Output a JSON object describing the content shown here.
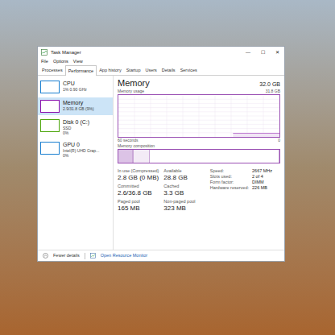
{
  "window": {
    "title": "Task Manager",
    "controls": [
      "—",
      "☐",
      "✕"
    ]
  },
  "menu": [
    "File",
    "Options",
    "View"
  ],
  "tabs": [
    {
      "label": "Processes",
      "selected": false
    },
    {
      "label": "Performance",
      "selected": true
    },
    {
      "label": "App history",
      "selected": false
    },
    {
      "label": "Startup",
      "selected": false
    },
    {
      "label": "Users",
      "selected": false
    },
    {
      "label": "Details",
      "selected": false
    },
    {
      "label": "Services",
      "selected": false
    }
  ],
  "sidebar": {
    "items": [
      {
        "name": "CPU",
        "details": [
          "1%  0.90 GHz"
        ],
        "selected": false,
        "color": "#1a7fd0"
      },
      {
        "name": "Memory",
        "details": [
          "2.9/31.8 GB (9%)"
        ],
        "selected": true,
        "color": "#8b12ae"
      },
      {
        "name": "Disk 0 (C:)",
        "details": [
          "SSD",
          "0%"
        ],
        "selected": false,
        "color": "#4da60c"
      },
      {
        "name": "GPU 0",
        "details": [
          "Intel(R) UHD Grap...",
          "0%"
        ],
        "selected": false,
        "color": "#1a7fd0"
      }
    ]
  },
  "panel": {
    "title": "Memory",
    "total": "32.0 GB",
    "usage_label": "Memory usage",
    "usage_max": "31.8 GB",
    "time_label": "60 seconds",
    "min_label": "0",
    "composition_label": "Memory composition",
    "usage_max_value": 31.8,
    "usage_series": [
      2.9,
      2.9,
      2.9,
      2.9,
      2.9,
      2.9,
      2.9,
      2.9,
      2.9,
      2.9,
      2.9,
      2.9,
      2.9,
      2.9,
      2.9,
      2.9,
      2.9,
      2.9
    ],
    "composition": [
      {
        "level": 0.09,
        "color": "#dcc3e6"
      },
      {
        "level": 0.006,
        "color": "#b88bc9"
      },
      {
        "level": 0.1,
        "color": "#f3ebf6"
      },
      {
        "level": 0.804,
        "color": "#ffffff"
      }
    ]
  },
  "stats": [
    {
      "label": "In use (Compressed)",
      "value": "2.8 GB (0 MB)"
    },
    {
      "label": "Available",
      "value": "28.8 GB"
    },
    {
      "label": "Committed",
      "value": "2.6/36.8 GB"
    },
    {
      "label": "Cached",
      "value": "3.3 GB"
    },
    {
      "label": "Paged pool",
      "value": "165 MB"
    },
    {
      "label": "Non-paged pool",
      "value": "323 MB"
    }
  ],
  "specs": [
    {
      "label": "Speed:",
      "value": "2667 MHz"
    },
    {
      "label": "Slots used:",
      "value": "2 of 4"
    },
    {
      "label": "Form factor:",
      "value": "DIMM"
    },
    {
      "label": "Hardware reserved:",
      "value": "226 MB"
    }
  ],
  "footer": {
    "fewer": "Fewer details",
    "monitor": "Open Resource Monitor"
  }
}
